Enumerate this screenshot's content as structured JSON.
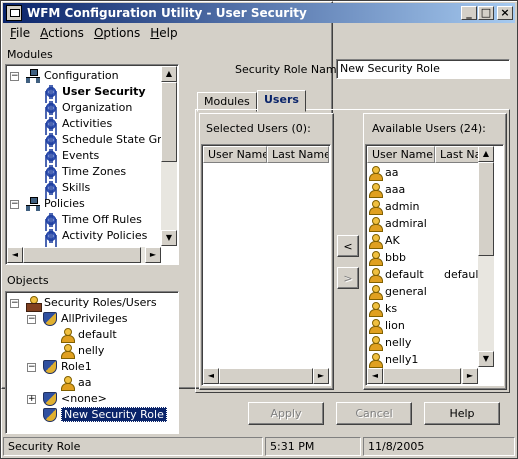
{
  "window": {
    "title": "WFM Configuration Utility - User Security"
  },
  "menu": [
    {
      "label": "File",
      "accel": "F",
      "rest": "ile"
    },
    {
      "label": "Actions",
      "accel": "A",
      "rest": "ctions"
    },
    {
      "label": "Options",
      "accel": "O",
      "rest": "ptions"
    },
    {
      "label": "Help",
      "accel": "H",
      "rest": "elp"
    }
  ],
  "modules": {
    "header": "Modules",
    "tree": [
      {
        "label": "Configuration",
        "icon": "network-icon",
        "expander": "minus",
        "level": 0
      },
      {
        "label": "User Security",
        "icon": "gear-icon",
        "level": 1,
        "bold": true
      },
      {
        "label": "Organization",
        "icon": "gear-icon",
        "level": 1
      },
      {
        "label": "Activities",
        "icon": "gear-icon",
        "level": 1
      },
      {
        "label": "Schedule State Grou",
        "icon": "gear-icon",
        "level": 1
      },
      {
        "label": "Events",
        "icon": "gear-icon",
        "level": 1
      },
      {
        "label": "Time Zones",
        "icon": "gear-icon",
        "level": 1
      },
      {
        "label": "Skills",
        "icon": "gear-icon",
        "level": 1
      },
      {
        "label": "Policies",
        "icon": "network-icon",
        "expander": "minus",
        "level": 0
      },
      {
        "label": "Time Off Rules",
        "icon": "gear-icon",
        "level": 1
      },
      {
        "label": "Activity Policies",
        "icon": "gear-icon",
        "level": 1
      }
    ]
  },
  "objects": {
    "header": "Objects",
    "tree": [
      {
        "label": "Security Roles/Users",
        "icon": "roles-icon",
        "expander": "minus",
        "level": 0
      },
      {
        "label": "AllPrivileges",
        "icon": "shield-icon",
        "expander": "minus",
        "level": 1
      },
      {
        "label": "default",
        "icon": "user-icon",
        "level": 2
      },
      {
        "label": "nelly",
        "icon": "user-icon",
        "level": 2
      },
      {
        "label": "Role1",
        "icon": "shield-icon",
        "expander": "minus",
        "level": 1
      },
      {
        "label": "aa",
        "icon": "user-icon",
        "level": 2
      },
      {
        "label": "<none>",
        "icon": "shield-icon",
        "expander": "plus",
        "level": 1
      },
      {
        "label": "New Security Role",
        "icon": "shield-icon",
        "level": 1,
        "selected": true
      }
    ]
  },
  "role": {
    "name_label": "Security Role Name:",
    "name_value": "New Security Role"
  },
  "tabs": [
    {
      "label": "Modules",
      "active": false
    },
    {
      "label": "Users",
      "active": true
    }
  ],
  "selected_users": {
    "title": "Selected Users (0):",
    "columns": [
      "User Name",
      "Last Name"
    ],
    "rows": []
  },
  "available_users": {
    "title": "Available Users (24):",
    "columns": [
      "User Name",
      "Last Na"
    ],
    "rows": [
      {
        "user": "aa",
        "last": ""
      },
      {
        "user": "aaa",
        "last": ""
      },
      {
        "user": "admin",
        "last": ""
      },
      {
        "user": "admiral",
        "last": ""
      },
      {
        "user": "AK",
        "last": ""
      },
      {
        "user": "bbb",
        "last": ""
      },
      {
        "user": "default",
        "last": "default"
      },
      {
        "user": "general",
        "last": ""
      },
      {
        "user": "ks",
        "last": ""
      },
      {
        "user": "lion",
        "last": ""
      },
      {
        "user": "nelly",
        "last": ""
      },
      {
        "user": "nelly1",
        "last": ""
      }
    ]
  },
  "transfer": {
    "add_label": "<",
    "remove_label": ">"
  },
  "buttons": {
    "apply": "Apply",
    "cancel": "Cancel",
    "help": "Help"
  },
  "status": {
    "text": "Security Role",
    "time": "5:31 PM",
    "date": "11/8/2005"
  }
}
